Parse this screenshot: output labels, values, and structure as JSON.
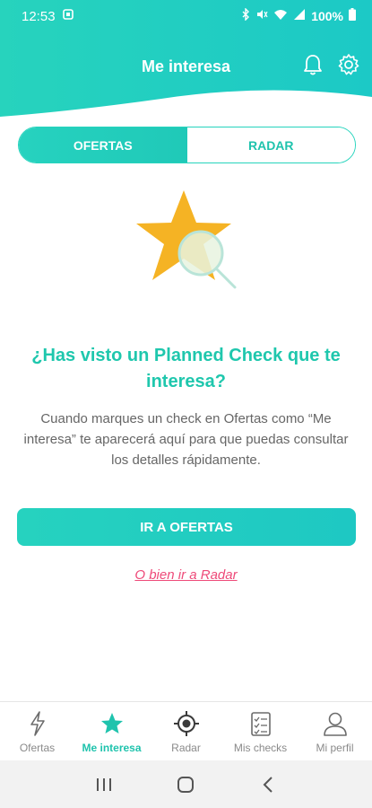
{
  "status_bar": {
    "time": "12:53",
    "battery": "100%"
  },
  "header": {
    "title": "Me interesa",
    "icons": [
      "bell-icon",
      "gear-icon"
    ]
  },
  "tabs": [
    {
      "label": "OFERTAS",
      "active": true
    },
    {
      "label": "RADAR",
      "active": false
    }
  ],
  "empty_state": {
    "title": "¿Has visto un Planned Check que te interesa?",
    "description": "Cuando marques un check en Ofertas como “Me interesa” te aparecerá aquí para que puedas consultar los detalles rápidamente.",
    "primary_button": "IR A OFERTAS",
    "secondary_link": "O bien ir a Radar"
  },
  "bottom_nav": [
    {
      "label": "Ofertas",
      "icon": "lightning-icon",
      "active": false
    },
    {
      "label": "Me interesa",
      "icon": "star-icon",
      "active": true
    },
    {
      "label": "Radar",
      "icon": "radar-icon",
      "active": false
    },
    {
      "label": "Mis checks",
      "icon": "checklist-icon",
      "active": false
    },
    {
      "label": "Mi perfil",
      "icon": "profile-icon",
      "active": false
    }
  ],
  "colors": {
    "accent": "#1fc7ad",
    "link": "#ee4a79",
    "star": "#f5b324"
  }
}
